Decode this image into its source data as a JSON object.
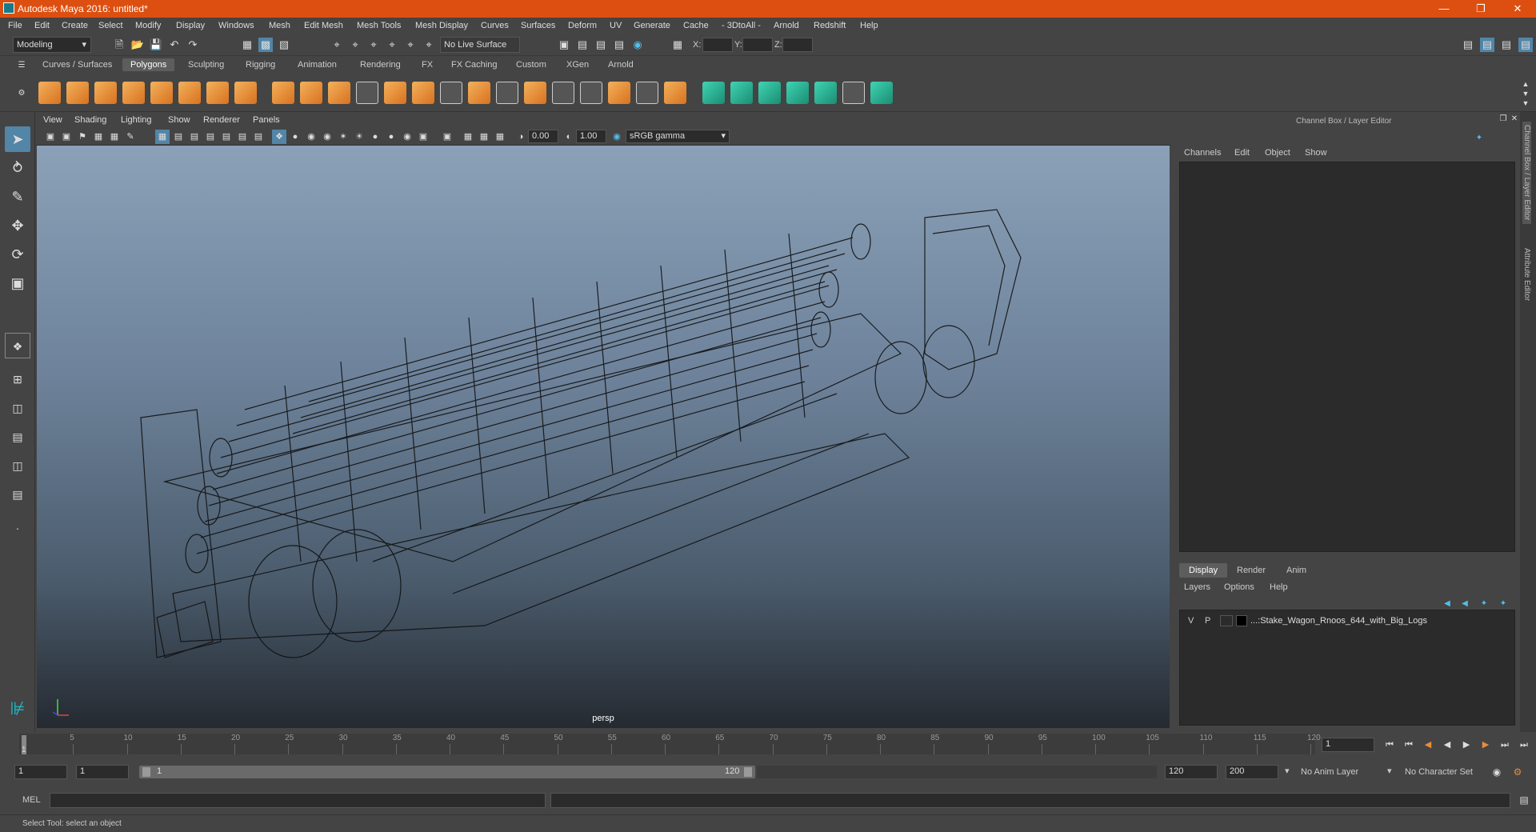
{
  "title": "Autodesk Maya 2016: untitled*",
  "menu": [
    "File",
    "Edit",
    "Create",
    "Select",
    "Modify",
    "Display",
    "Windows",
    "Mesh",
    "Edit Mesh",
    "Mesh Tools",
    "Mesh Display",
    "Curves",
    "Surfaces",
    "Deform",
    "UV",
    "Generate",
    "Cache",
    "- 3DtoAll -",
    "Arnold",
    "Redshift",
    "Help"
  ],
  "status": {
    "workspace": "Modeling",
    "live_surface": "No Live Surface",
    "x_label": "X:",
    "y_label": "Y:",
    "z_label": "Z:"
  },
  "shelf_tabs": [
    "Curves / Surfaces",
    "Polygons",
    "Sculpting",
    "Rigging",
    "Animation",
    "Rendering",
    "FX",
    "FX Caching",
    "Custom",
    "XGen",
    "Arnold"
  ],
  "active_shelf_tab": "Polygons",
  "viewport": {
    "menu": [
      "View",
      "Shading",
      "Lighting",
      "Show",
      "Renderer",
      "Panels"
    ],
    "exposure": "0.00",
    "gamma": "1.00",
    "color_space": "sRGB gamma",
    "camera": "persp"
  },
  "channel_box": {
    "title": "Channel Box / Layer Editor",
    "menu": [
      "Channels",
      "Edit",
      "Object",
      "Show"
    ]
  },
  "layer_editor": {
    "tabs": [
      "Display",
      "Render",
      "Anim"
    ],
    "menu": [
      "Layers",
      "Options",
      "Help"
    ],
    "layers": [
      {
        "v": "V",
        "p": "P",
        "name": "...:Stake_Wagon_Rnoos_644_with_Big_Logs"
      }
    ]
  },
  "side_tabs": [
    "Channel Box / Layer Editor",
    "Attribute Editor"
  ],
  "timeline": {
    "ticks": [
      "5",
      "10",
      "15",
      "20",
      "25",
      "30",
      "35",
      "40",
      "45",
      "50",
      "55",
      "60",
      "65",
      "70",
      "75",
      "80",
      "85",
      "90",
      "95",
      "100",
      "105",
      "110",
      "115",
      "120"
    ],
    "start_marker": "1",
    "current_frame": "1"
  },
  "range": {
    "start": "1",
    "playback_start": "1",
    "slider_start": "1",
    "slider_end": "120",
    "playback_end": "120",
    "end": "200",
    "anim_layer": "No Anim Layer",
    "character_set": "No Character Set"
  },
  "command": {
    "label": "MEL"
  },
  "help_line": "Select Tool: select an object"
}
